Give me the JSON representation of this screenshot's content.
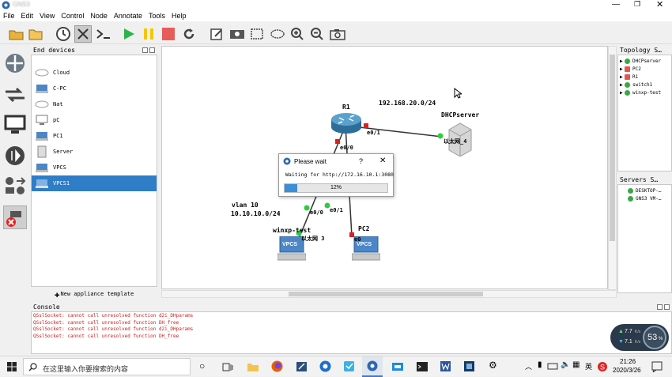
{
  "window": {
    "title": "GNS3"
  },
  "menu": [
    "File",
    "Edit",
    "View",
    "Control",
    "Node",
    "Annotate",
    "Tools",
    "Help"
  ],
  "toolbar": {
    "icons": [
      "open-project-icon",
      "open-folder-icon",
      "snapshot-icon",
      "show-interfaces-icon",
      "console-all-icon",
      "start-icon",
      "suspend-icon",
      "stop-icon",
      "reload-icon",
      "add-note-icon",
      "insert-image-icon",
      "draw-rectangle-icon",
      "draw-ellipse-icon",
      "zoom-in-icon",
      "zoom-out-icon",
      "screenshot-icon"
    ]
  },
  "end_devices": {
    "title": "End devices",
    "items": [
      {
        "label": "Cloud",
        "icon": "cloud-icon"
      },
      {
        "label": "C-PC",
        "icon": "vpcs-icon"
      },
      {
        "label": "Nat",
        "icon": "cloud-icon"
      },
      {
        "label": "pC",
        "icon": "computer-icon"
      },
      {
        "label": "PC1",
        "icon": "vpcs-icon"
      },
      {
        "label": "Server",
        "icon": "server-icon"
      },
      {
        "label": "VPCS",
        "icon": "vpcs-icon"
      },
      {
        "label": "VPCS1",
        "icon": "vpcs-icon",
        "selected": true
      }
    ],
    "new_template": "New appliance template"
  },
  "topology": {
    "labels": {
      "subnet_top": "192.168.20.0/24",
      "vlan": "vlan 10",
      "subnet_left": "10.10.10.0/24"
    },
    "nodes": {
      "r1": "R1",
      "dhcp": "DHCPserver",
      "dhcp_port": "以太网_4",
      "winxp": "winxp-test",
      "winxp_port": "以太网 3",
      "pc2": "PC2",
      "pc2_port": "e0"
    },
    "ports": {
      "r1_e01": "e0/1",
      "r1_e00": "e0/0",
      "sw_e00": "e0/0",
      "sw_e01": "e0/1"
    },
    "vpcs_badge": "VPCS"
  },
  "topology_summary": {
    "title": "Topology S…",
    "items": [
      {
        "label": "DHCPserver",
        "status": "#39a845"
      },
      {
        "label": "PC2",
        "status": "#e2574c"
      },
      {
        "label": "R1",
        "status": "#e2574c"
      },
      {
        "label": "switch1",
        "status": "#39a845"
      },
      {
        "label": "winxp-test",
        "status": "#39a845"
      }
    ]
  },
  "servers_summary": {
    "title": "Servers S…",
    "items": [
      {
        "label": "DESKTOP-…",
        "status": "#39a845"
      },
      {
        "label": "GNS3 VM-…",
        "status": "#39a845"
      }
    ]
  },
  "console": {
    "title": "Console",
    "lines": [
      "QSslSocket: cannot call unresolved function d2i_DHparams",
      "QSslSocket: cannot call unresolved function DH_free",
      "QSslSocket: cannot call unresolved function d2i_DHparams",
      "QSslSocket: cannot call unresolved function DH_free"
    ]
  },
  "dialog": {
    "title": "Please wait",
    "help": "?",
    "close": "✕",
    "message": "Waiting for http://172.16.10.1:3080",
    "progress": 0.12,
    "progress_text": "12%"
  },
  "network_widget": {
    "up": "7.7",
    "up_unit": "K/s",
    "down": "7.1",
    "down_unit": "K/s",
    "cpu": "53",
    "cpu_unit": "%"
  },
  "taskbar": {
    "search_placeholder": "在这里输入你要搜索的内容",
    "time": "21:26",
    "date": "2020/3/26",
    "ime": "英"
  },
  "colors": {
    "selection": "#2f7dc7",
    "link": "#333333",
    "port_up": "#2ecc40",
    "port_down": "#e01e1e",
    "progress": "#3b8fd6"
  }
}
